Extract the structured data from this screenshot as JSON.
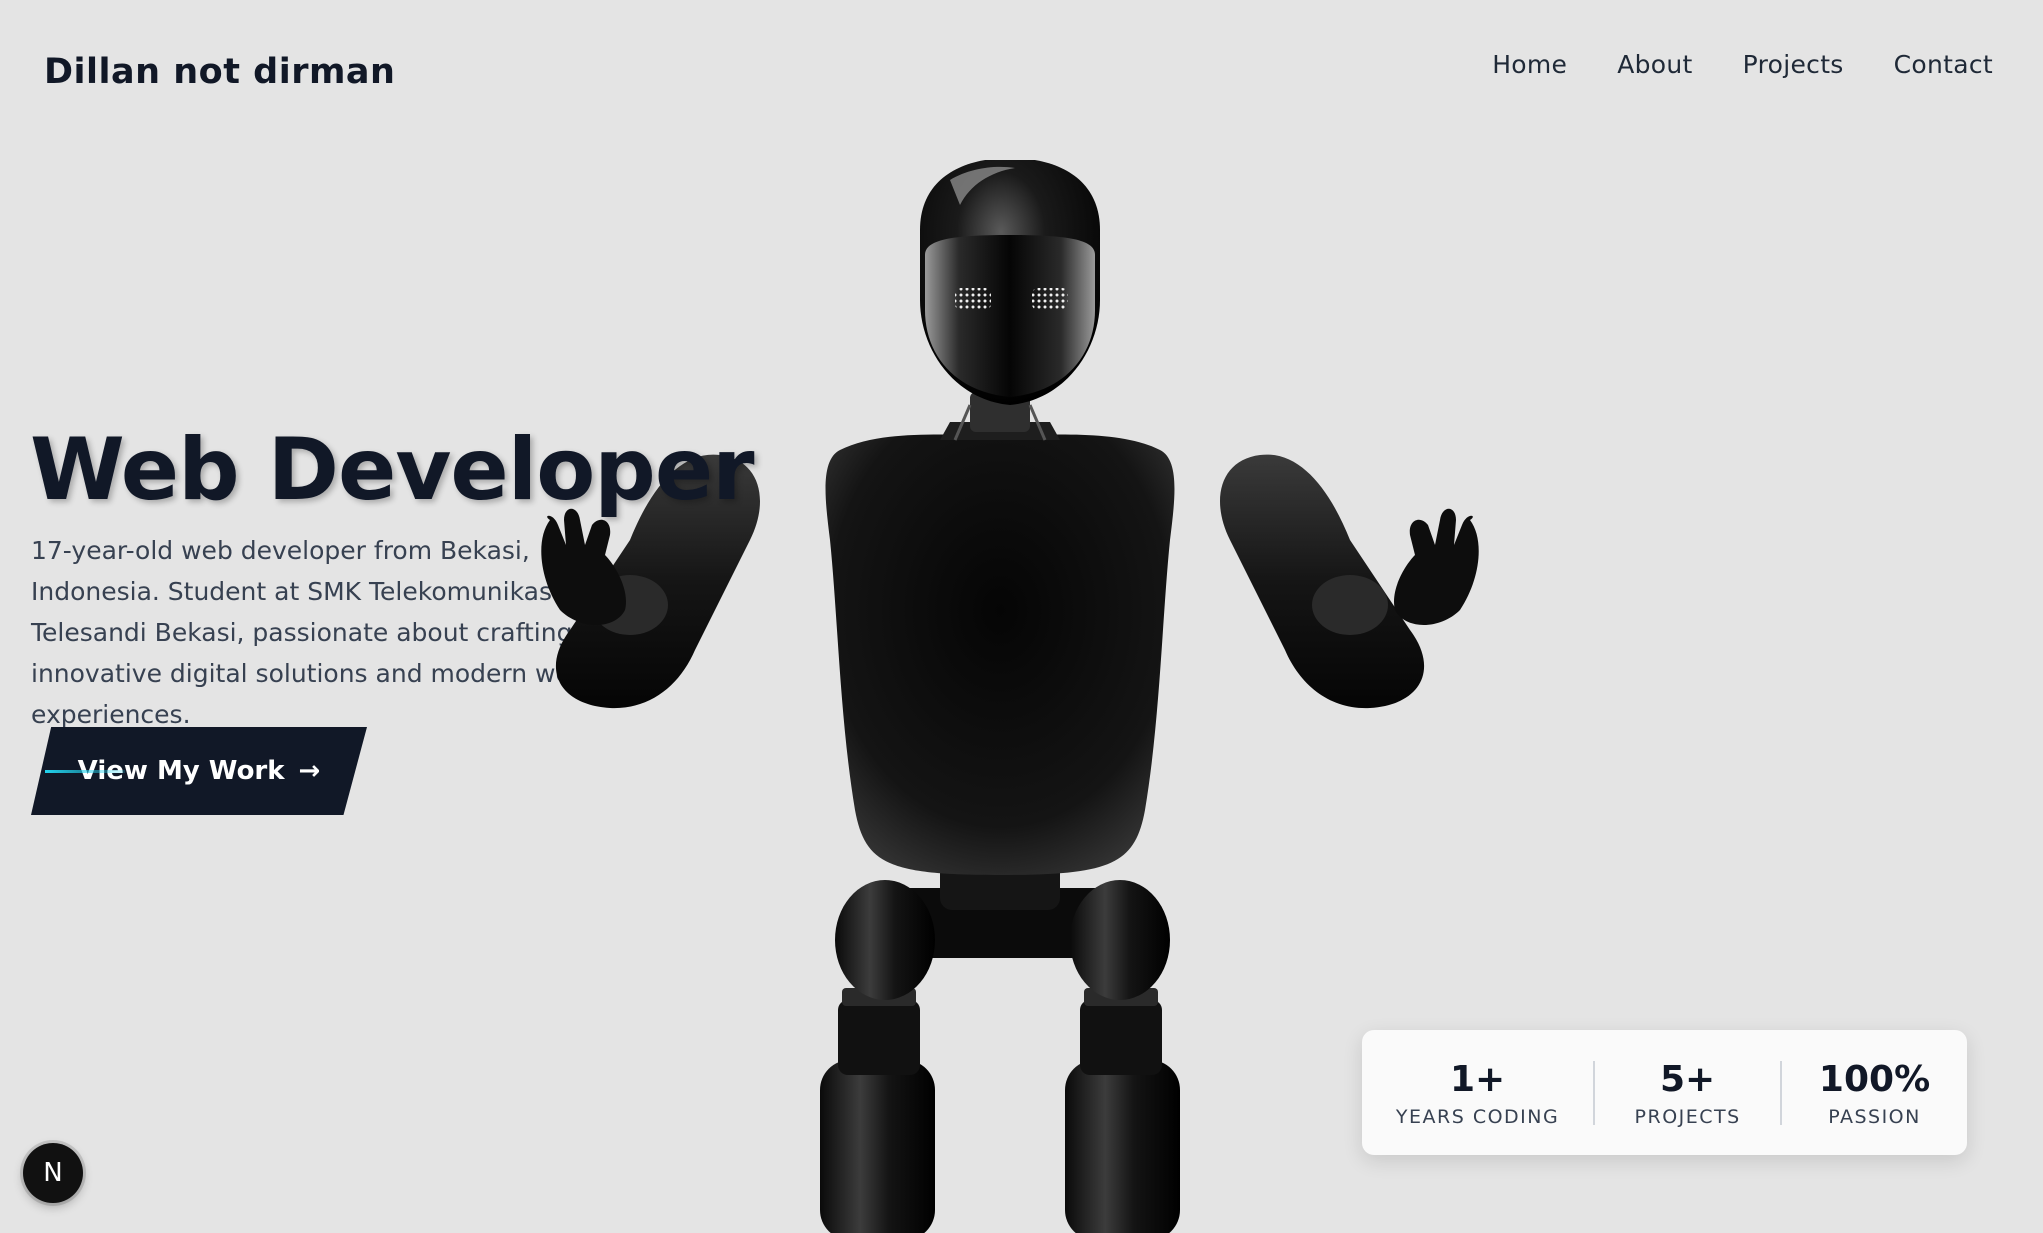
{
  "header": {
    "brand": "Dillan not dirman",
    "nav": [
      {
        "label": "Home"
      },
      {
        "label": "About"
      },
      {
        "label": "Projects"
      },
      {
        "label": "Contact"
      }
    ]
  },
  "hero": {
    "title": "Web Developer",
    "description": "17-year-old web developer from Bekasi, Indonesia. Student at SMK Telekomunikasi Telesandi Bekasi, passionate about crafting innovative digital solutions and modern web experiences.",
    "cta_label": "View My Work",
    "cta_icon": "arrow-right-icon"
  },
  "stats": [
    {
      "value": "1+",
      "label": "YEARS CODING"
    },
    {
      "value": "5+",
      "label": "PROJECTS"
    },
    {
      "value": "100%",
      "label": "PASSION"
    }
  ],
  "badge": {
    "letter": "N",
    "icon": "nextjs-icon"
  },
  "colors": {
    "background": "#e4e4e4",
    "text_dark": "#111827",
    "cta_bg": "#111827",
    "cta_accent": "#22d3ee",
    "card_bg": "#fafafa"
  }
}
